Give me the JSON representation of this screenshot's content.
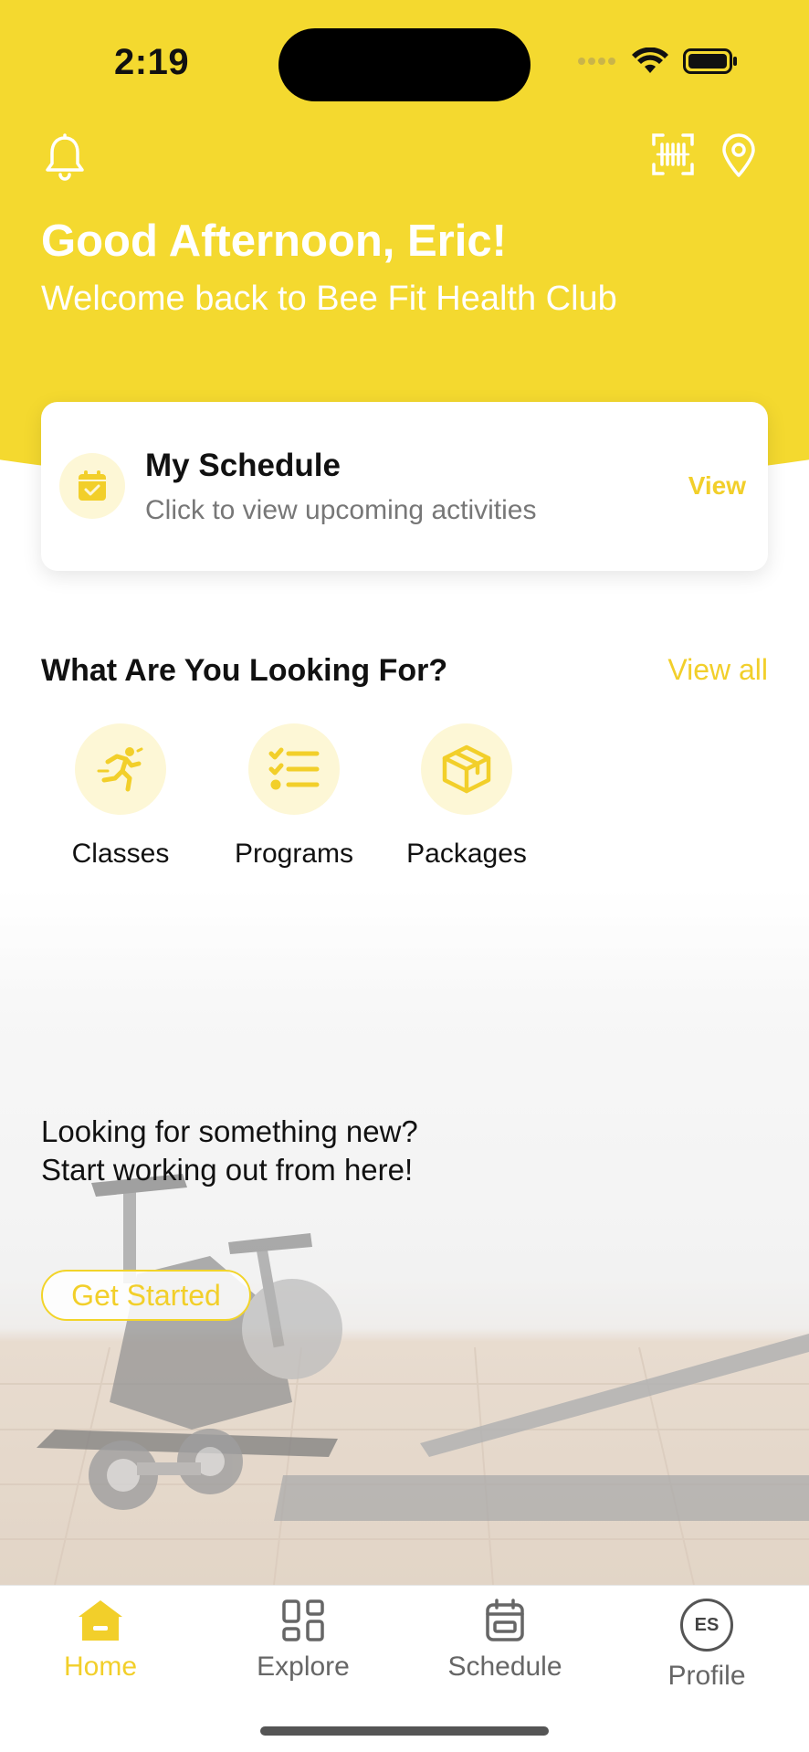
{
  "status_bar": {
    "time": "2:19"
  },
  "header": {
    "greeting": "Good Afternoon, Eric!",
    "welcome": "Welcome back to Bee Fit Health Club",
    "icons": [
      "bell-icon",
      "barcode-scan-icon",
      "location-pin-icon"
    ]
  },
  "schedule_card": {
    "title": "My Schedule",
    "subtitle": "Click to view upcoming activities",
    "action": "View"
  },
  "looking_for": {
    "title": "What Are You Looking For?",
    "view_all": "View all",
    "categories": [
      {
        "label": "Classes",
        "icon": "running-person-icon"
      },
      {
        "label": "Programs",
        "icon": "checklist-icon"
      },
      {
        "label": "Packages",
        "icon": "box-icon"
      }
    ]
  },
  "promo": {
    "line1": "Looking for something new?",
    "line2": "Start working out from here!",
    "button": "Get Started"
  },
  "tabbar": {
    "tabs": [
      {
        "label": "Home",
        "icon": "home-icon",
        "active": true
      },
      {
        "label": "Explore",
        "icon": "grid-icon",
        "active": false
      },
      {
        "label": "Schedule",
        "icon": "calendar-icon",
        "active": false
      },
      {
        "label": "Profile",
        "icon": "avatar",
        "active": false
      }
    ],
    "avatar_initials": "ES"
  },
  "colors": {
    "brand_yellow": "#f4d92f",
    "accent_text": "#f2cf2a",
    "icon_bg": "#fdf7d6"
  }
}
